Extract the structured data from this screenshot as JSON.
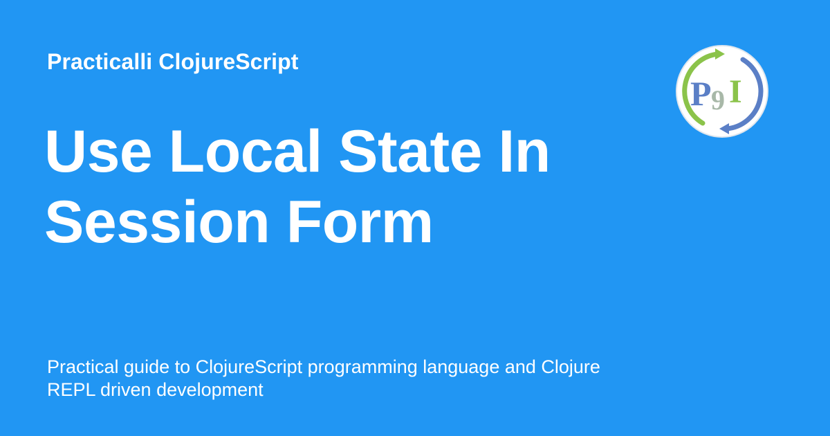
{
  "header": {
    "site_name": "Practicalli ClojureScript"
  },
  "title": {
    "line1": "Use Local State In",
    "line2": "Session Form"
  },
  "description": {
    "line1": "Practical guide to ClojureScript programming language and Clojure",
    "line2": "REPL driven development"
  },
  "logo": {
    "icon": "practicalli-logo-icon",
    "letters": {
      "p": "P",
      "nine": "9",
      "i": "I"
    }
  },
  "colors": {
    "background": "#2196f3",
    "text": "#ffffff",
    "logo_green": "#8bc34a",
    "logo_blue": "#5b7fc6",
    "logo_gray": "#a8b8a8"
  }
}
